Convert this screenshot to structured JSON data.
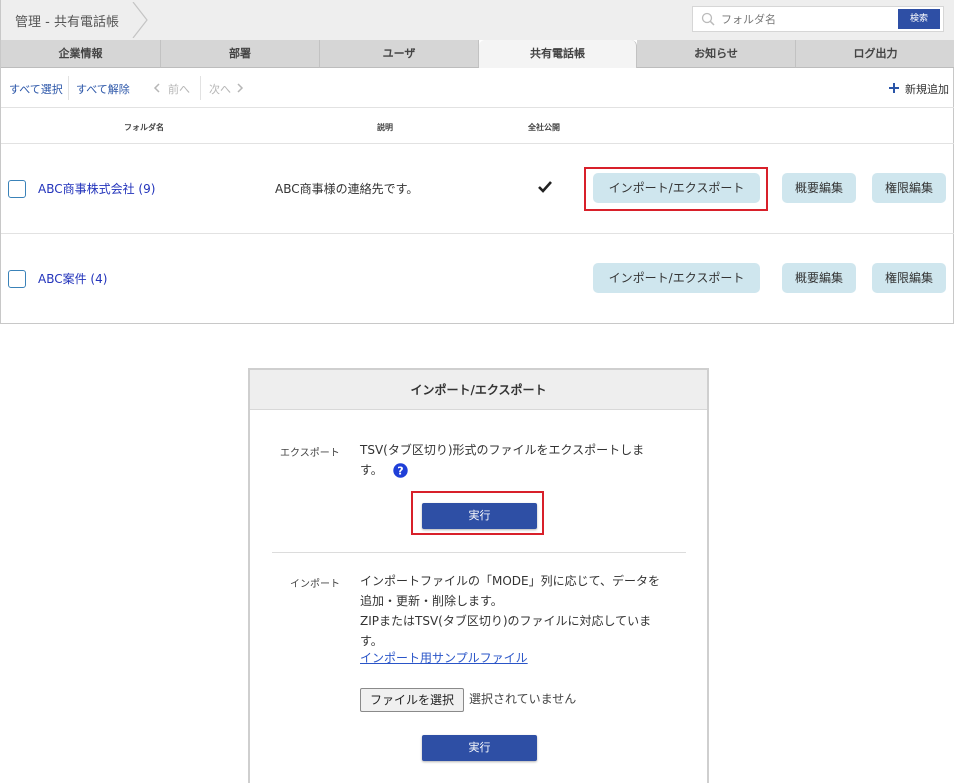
{
  "header": {
    "breadcrumb": "管理 - 共有電話帳",
    "search_placeholder": "フォルダ名",
    "search_button": "検索"
  },
  "tabs": [
    {
      "label": "企業情報",
      "active": false
    },
    {
      "label": "部署",
      "active": false
    },
    {
      "label": "ユーザ",
      "active": false
    },
    {
      "label": "共有電話帳",
      "active": true
    },
    {
      "label": "お知らせ",
      "active": false
    },
    {
      "label": "ログ出力",
      "active": false
    }
  ],
  "toolbar": {
    "select_all": "すべて選択",
    "deselect_all": "すべて解除",
    "prev": "前へ",
    "next": "次へ",
    "add_new": "新規追加"
  },
  "table": {
    "columns": {
      "folder": "フォルダ名",
      "description": "説明",
      "public": "全社公開"
    },
    "rows": [
      {
        "name": "ABC商事株式会社 (9)",
        "description": "ABC商事様の連絡先です。",
        "public": true
      },
      {
        "name": "ABC案件 (4)",
        "description": "",
        "public": false
      }
    ],
    "actions": {
      "import_export": "インポート/エクスポート",
      "edit_summary": "概要編集",
      "edit_permissions": "権限編集"
    }
  },
  "dialog": {
    "title": "インポート/エクスポート",
    "export_label": "エクスポート",
    "export_line1": "TSV(タブ区切り)形式のファイルをエクスポートしま",
    "export_line2": "す。",
    "run_label": "実行",
    "import_label": "インポート",
    "import_line1": "インポートファイルの「MODE」列に応じて、データを",
    "import_line2": "追加・更新・削除します。",
    "import_line3": "ZIPまたはTSV(タブ区切り)のファイルに対応していま",
    "import_line4": "す。",
    "sample_link": "インポート用サンプルファイル",
    "choose_file": "ファイルを選択",
    "no_file": "選択されていません"
  },
  "colors": {
    "accent": "#2e4fa5",
    "pill": "#cfe6ee",
    "highlight": "#d8202a",
    "link": "#2233bb"
  }
}
